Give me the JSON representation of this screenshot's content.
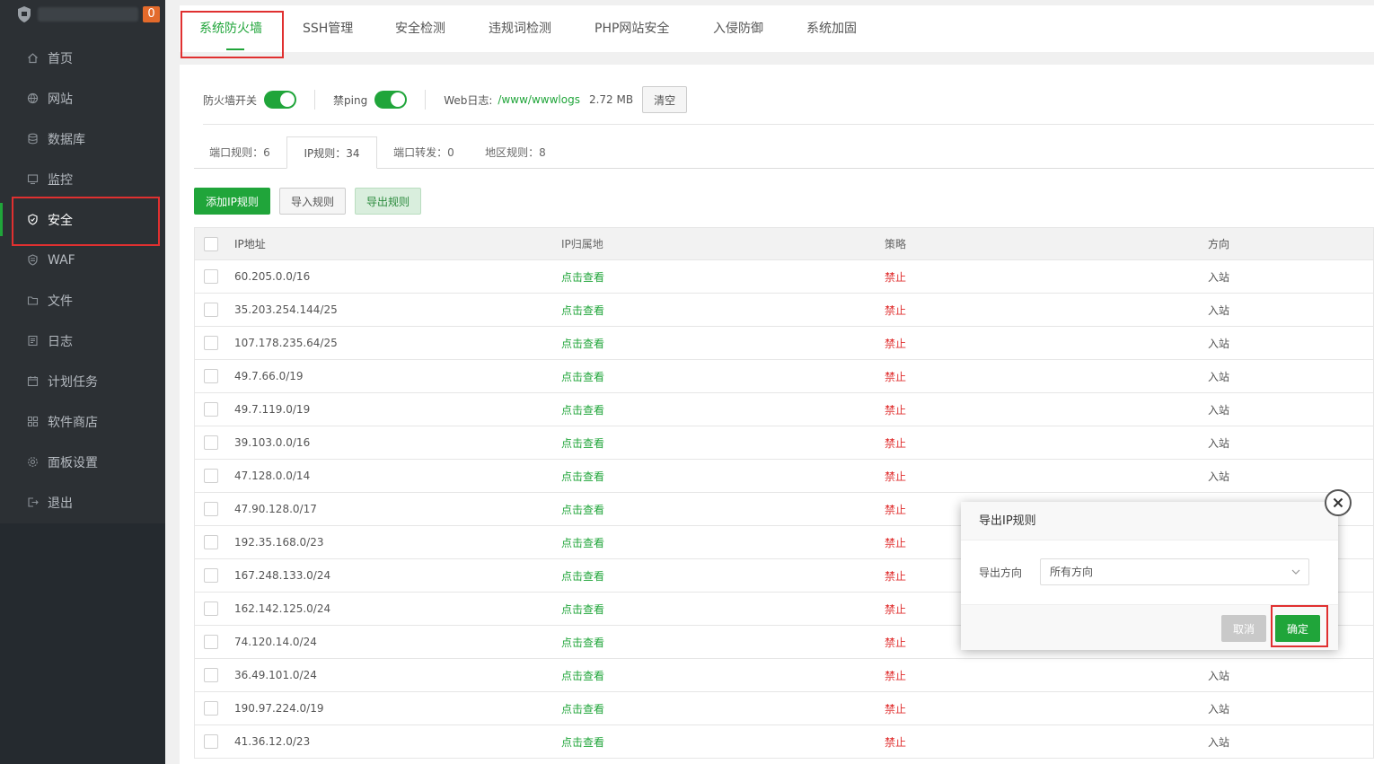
{
  "sidebar": {
    "badge": "0",
    "items": [
      {
        "label": "首页",
        "icon": "home-icon"
      },
      {
        "label": "网站",
        "icon": "globe-icon"
      },
      {
        "label": "数据库",
        "icon": "database-icon"
      },
      {
        "label": "监控",
        "icon": "monitor-icon"
      },
      {
        "label": "安全",
        "icon": "shield-icon"
      },
      {
        "label": "WAF",
        "icon": "waf-shield-icon"
      },
      {
        "label": "文件",
        "icon": "folder-icon"
      },
      {
        "label": "日志",
        "icon": "log-icon"
      },
      {
        "label": "计划任务",
        "icon": "calendar-icon"
      },
      {
        "label": "软件商店",
        "icon": "apps-icon"
      },
      {
        "label": "面板设置",
        "icon": "gear-icon"
      },
      {
        "label": "退出",
        "icon": "logout-icon"
      }
    ]
  },
  "top_tabs": [
    "系统防火墙",
    "SSH管理",
    "安全检测",
    "违规词检测",
    "PHP网站安全",
    "入侵防御",
    "系统加固"
  ],
  "toolbar": {
    "firewall_label": "防火墙开关",
    "ping_label": "禁ping",
    "weblog_label": "Web日志:",
    "weblog_path": "/www/wwwlogs",
    "weblog_size": "2.72 MB",
    "clear_label": "清空"
  },
  "sub_tabs": [
    "端口规则：6",
    "IP规则：34",
    "端口转发：0",
    "地区规则：8"
  ],
  "actions": {
    "add": "添加IP规则",
    "import": "导入规则",
    "export": "导出规则"
  },
  "table": {
    "headers": [
      "IP地址",
      "IP归属地",
      "策略",
      "方向"
    ],
    "rows": [
      {
        "ip": "60.205.0.0/16",
        "loc": "点击查看",
        "policy": "禁止",
        "dir": "入站"
      },
      {
        "ip": "35.203.254.144/25",
        "loc": "点击查看",
        "policy": "禁止",
        "dir": "入站"
      },
      {
        "ip": "107.178.235.64/25",
        "loc": "点击查看",
        "policy": "禁止",
        "dir": "入站"
      },
      {
        "ip": "49.7.66.0/19",
        "loc": "点击查看",
        "policy": "禁止",
        "dir": "入站"
      },
      {
        "ip": "49.7.119.0/19",
        "loc": "点击查看",
        "policy": "禁止",
        "dir": "入站"
      },
      {
        "ip": "39.103.0.0/16",
        "loc": "点击查看",
        "policy": "禁止",
        "dir": "入站"
      },
      {
        "ip": "47.128.0.0/14",
        "loc": "点击查看",
        "policy": "禁止",
        "dir": "入站"
      },
      {
        "ip": "47.90.128.0/17",
        "loc": "点击查看",
        "policy": "禁止",
        "dir": ""
      },
      {
        "ip": "192.35.168.0/23",
        "loc": "点击查看",
        "policy": "禁止",
        "dir": ""
      },
      {
        "ip": "167.248.133.0/24",
        "loc": "点击查看",
        "policy": "禁止",
        "dir": ""
      },
      {
        "ip": "162.142.125.0/24",
        "loc": "点击查看",
        "policy": "禁止",
        "dir": ""
      },
      {
        "ip": "74.120.14.0/24",
        "loc": "点击查看",
        "policy": "禁止",
        "dir": ""
      },
      {
        "ip": "36.49.101.0/24",
        "loc": "点击查看",
        "policy": "禁止",
        "dir": "入站"
      },
      {
        "ip": "190.97.224.0/19",
        "loc": "点击查看",
        "policy": "禁止",
        "dir": "入站"
      },
      {
        "ip": "41.36.12.0/23",
        "loc": "点击查看",
        "policy": "禁止",
        "dir": "入站"
      }
    ]
  },
  "modal": {
    "title": "导出IP规则",
    "field_label": "导出方向",
    "select_value": "所有方向",
    "cancel": "取消",
    "ok": "确定"
  },
  "colors": {
    "accent": "#20a53a",
    "danger": "#e03030",
    "sidebar": "#2c3034"
  }
}
